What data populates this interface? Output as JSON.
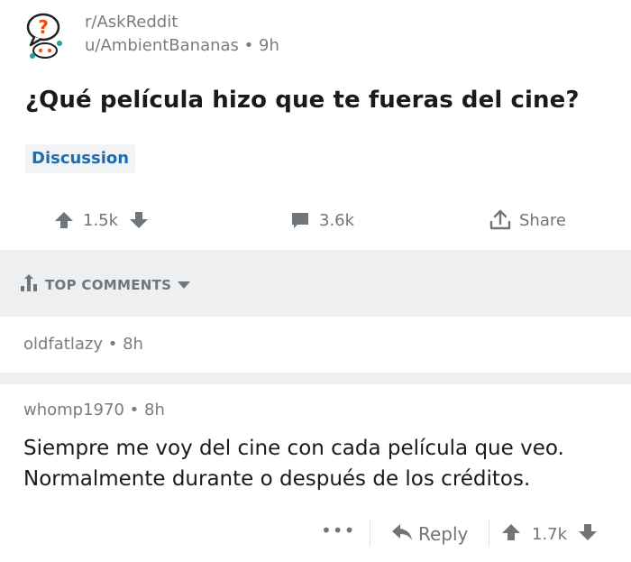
{
  "post": {
    "subreddit": "r/AskReddit",
    "author": "u/AmbientBananas",
    "age": "9h",
    "title": "¿Qué película hizo que te fueras del cine?",
    "flair": "Discussion",
    "score": "1.5k",
    "comments_count": "3.6k",
    "share_label": "Share"
  },
  "sort": {
    "label": "TOP COMMENTS"
  },
  "comments": [
    {
      "author": "oldfatlazy",
      "age": "8h"
    },
    {
      "author": "whomp1970",
      "age": "8h",
      "body_line1": "Siempre me voy del cine con cada película que veo.",
      "body_line2": "Normalmente durante o después de los créditos.",
      "more_label": "•••",
      "reply_label": "Reply",
      "score": "1.7k"
    }
  ],
  "colors": {
    "meta_gray": "#7c7c7c",
    "action_gray": "#6f7579",
    "flair_blue": "#1d6db2",
    "band_gray": "#edeff1",
    "icon_orange": "#ff4500",
    "icon_teal": "#24a0a0"
  }
}
